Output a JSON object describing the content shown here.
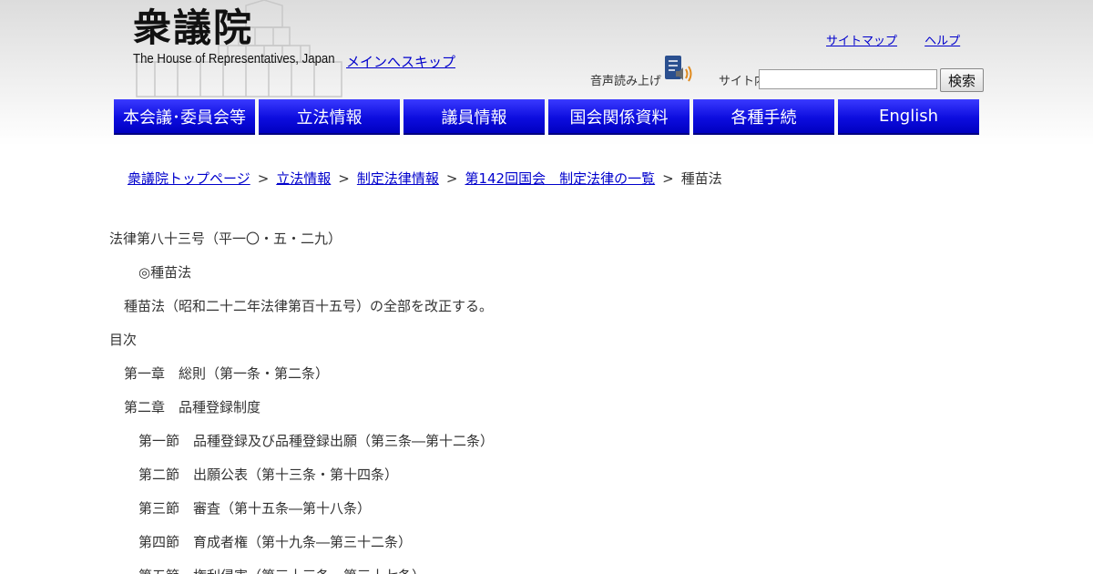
{
  "header": {
    "logo_jp": "衆議院",
    "logo_en": "The House of Representatives, Japan",
    "skip_link": "メインへスキップ",
    "sitemap": "サイトマップ",
    "help": "ヘルプ",
    "audio_label": "音声読み上げ",
    "search_label": "サイト内",
    "search_value": "",
    "search_button": "検索"
  },
  "nav": {
    "items": [
      "本会議･委員会等",
      "立法情報",
      "議員情報",
      "国会関係資料",
      "各種手続",
      "English"
    ]
  },
  "breadcrumb": {
    "items": [
      "衆議院トップページ",
      "立法情報",
      "制定法律情報",
      "第142回国会　制定法律の一覧"
    ],
    "separator": ">",
    "current": "種苗法"
  },
  "content": {
    "law_number": "法律第八十三号（平一〇・五・二九）",
    "law_title": "◎種苗法",
    "preamble": "種苗法（昭和二十二年法律第百十五号）の全部を改正する。",
    "toc_heading": "目次",
    "toc": [
      {
        "level": 1,
        "text": "第一章　総則（第一条・第二条）"
      },
      {
        "level": 1,
        "text": "第二章　品種登録制度"
      },
      {
        "level": 2,
        "text": "第一節　品種登録及び品種登録出願（第三条―第十二条）"
      },
      {
        "level": 2,
        "text": "第二節　出願公表（第十三条・第十四条）"
      },
      {
        "level": 2,
        "text": "第三節　審査（第十五条―第十八条）"
      },
      {
        "level": 2,
        "text": "第四節　育成者権（第十九条―第三十二条）"
      },
      {
        "level": 2,
        "text": "第五節　権利侵害（第三十三条―第三十七条）"
      }
    ]
  }
}
